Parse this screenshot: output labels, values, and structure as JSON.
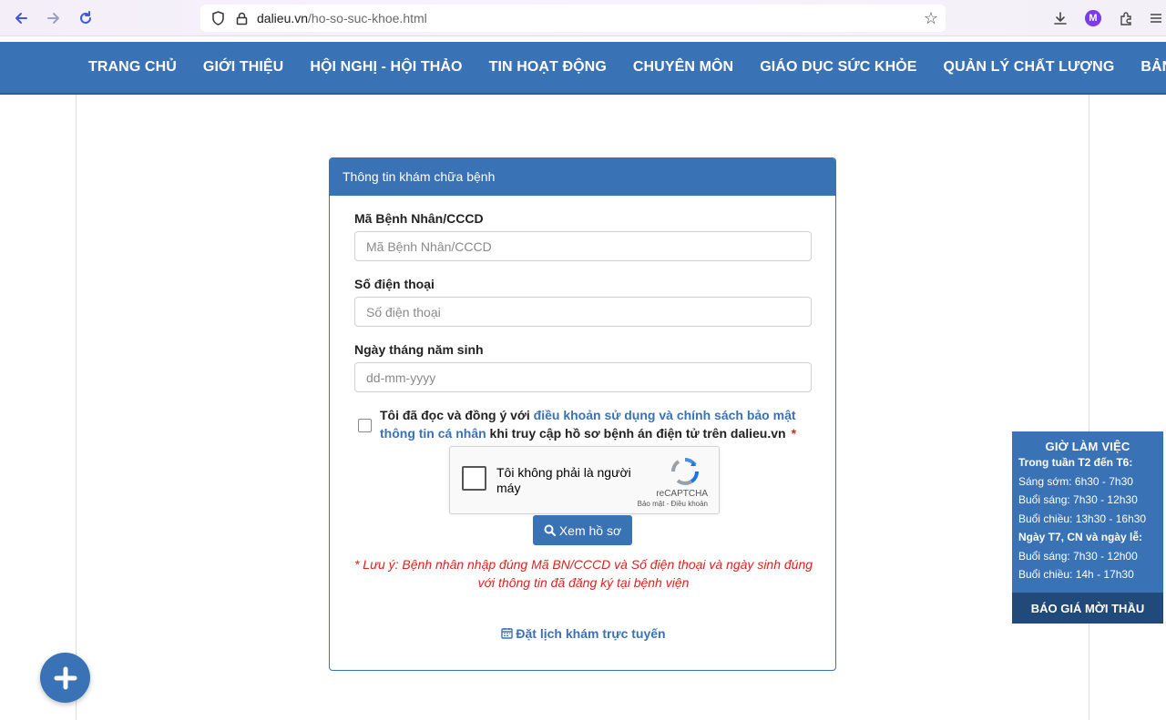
{
  "browser": {
    "url_domain": "dalieu.vn",
    "url_path": "/ho-so-suc-khoe.html",
    "profile_initial": "M"
  },
  "nav": {
    "items": [
      "TRANG CHỦ",
      "GIỚI THIỆU",
      "HỘI NGHỊ - HỘI THẢO",
      "TIN HOẠT ĐỘNG",
      "CHUYÊN MÔN",
      "GIÁO DỤC SỨC KHỎE",
      "QUẢN LÝ CHẤT LƯỢNG",
      "BẢNG GIÁ"
    ]
  },
  "form": {
    "header": "Thông tin khám chữa bệnh",
    "patient_id_label": "Mã Bệnh Nhân/CCCD",
    "patient_id_placeholder": "Mã Bệnh Nhân/CCCD",
    "phone_label": "Số điện thoại",
    "phone_placeholder": "Số điện thoại",
    "dob_label": "Ngày tháng năm sinh",
    "dob_placeholder": "dd-mm-yyyy",
    "agree_prefix": "Tôi đã đọc và đồng ý với ",
    "agree_link": "điều khoản sử dụng và chính sách bảo mật thông tin cá nhân",
    "agree_suffix": " khi truy cập hồ sơ bệnh án điện tử trên dalieu.vn",
    "required_mark": "*",
    "view_button": "Xem hồ sơ",
    "note": "* Lưu ý: Bệnh nhân nhập đúng Mã BN/CCCD và Số điện thoại và ngày sinh đúng với thông tin đã đăng ký tại bệnh viện",
    "booking_link": "Đặt lịch khám trực tuyến"
  },
  "recaptcha": {
    "label": "Tôi không phải là người máy",
    "brand": "reCAPTCHA",
    "terms": "Bảo mật - Điều khoản"
  },
  "hours": {
    "title": "GIỜ LÀM VIỆC",
    "weekday_heading": "Trong tuần T2 đến T6:",
    "early": "Sáng sớm: 6h30 - 7h30",
    "morning": "Buổi sáng: 7h30 - 12h30",
    "afternoon": "Buổi chiều: 13h30 - 16h30",
    "weekend_heading": "Ngày T7, CN và ngày lễ:",
    "weekend_morning": "Buổi sáng: 7h30 - 12h00",
    "weekend_afternoon": "Buổi chiều: 14h - 17h30",
    "bid_button": "BÁO GIÁ MỜI THẦU"
  }
}
